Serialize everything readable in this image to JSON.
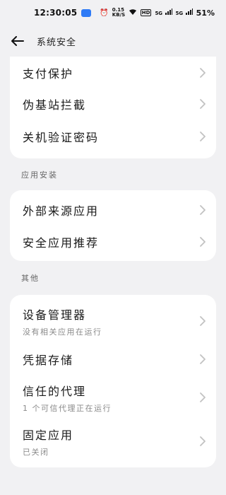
{
  "status_bar": {
    "time": "12:30:05",
    "speed": "0.15 KB/S",
    "hd": "HD",
    "signal_1": "5G",
    "signal_2": "5G",
    "battery": "51%"
  },
  "header": {
    "title": "系统安全"
  },
  "group_top": {
    "items": [
      {
        "label": "支付保护"
      },
      {
        "label": "伪基站拦截"
      },
      {
        "label": "关机验证密码"
      }
    ]
  },
  "group_install": {
    "title": "应用安装",
    "items": [
      {
        "label": "外部来源应用"
      },
      {
        "label": "安全应用推荐"
      }
    ]
  },
  "group_other": {
    "title": "其他",
    "items": [
      {
        "label": "设备管理器",
        "sub": "没有相关应用在运行"
      },
      {
        "label": "凭据存储"
      },
      {
        "label": "信任的代理",
        "sub": "1 个可信代理正在运行"
      },
      {
        "label": "固定应用",
        "sub": "已关闭"
      }
    ]
  },
  "colors": {
    "background": "#f1f1f3",
    "card": "#ffffff",
    "chevron": "#c2c2c2",
    "app_badge": "#2f7bf6"
  }
}
